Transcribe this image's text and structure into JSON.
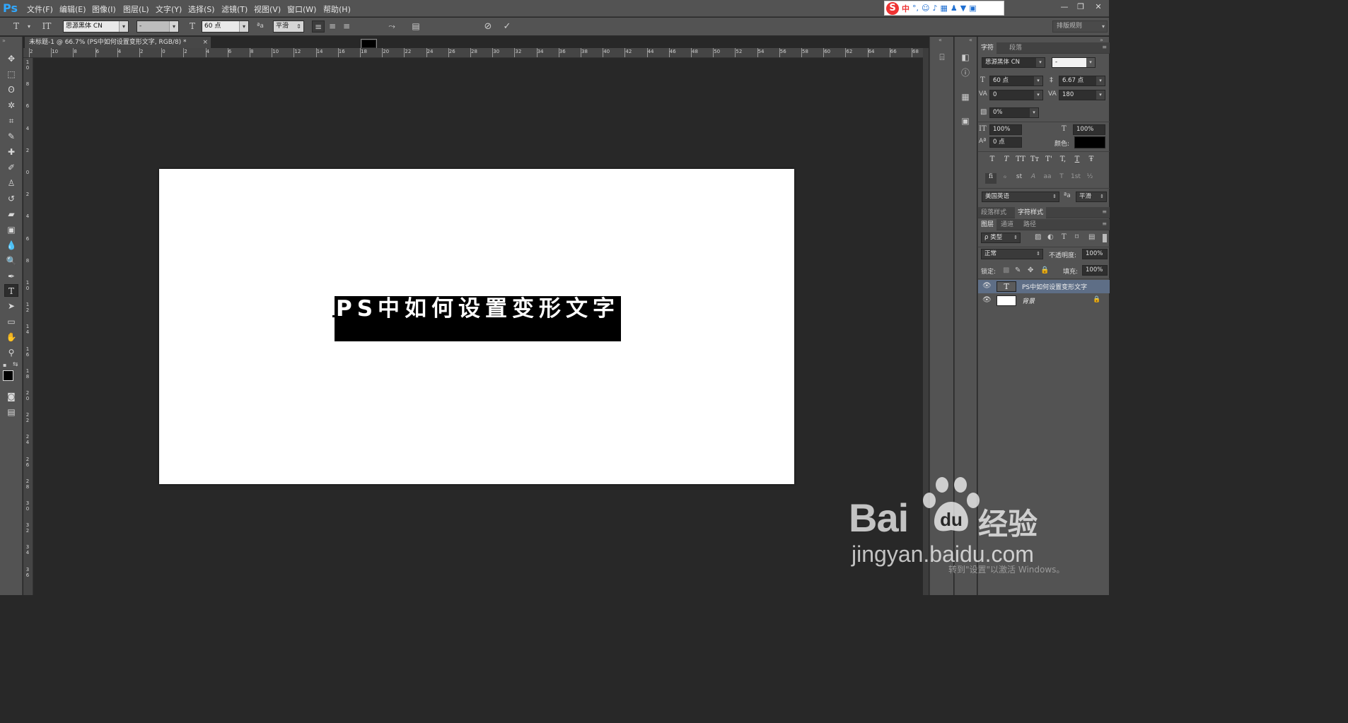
{
  "app": {
    "logo": "Ps"
  },
  "menu": [
    "文件(F)",
    "编辑(E)",
    "图像(I)",
    "图层(L)",
    "文字(Y)",
    "选择(S)",
    "滤镜(T)",
    "视图(V)",
    "窗口(W)",
    "帮助(H)"
  ],
  "ime": {
    "logo": "S",
    "mode": "中",
    "punct": "°,"
  },
  "window_controls": {
    "minimize": "—",
    "restore": "❐",
    "close": "✕"
  },
  "options": {
    "font_family": "思源黑体 CN",
    "font_style": "-",
    "font_size": "60 点",
    "antialias_icon_label": "ªa",
    "antialias": "平滑",
    "workspace": "排版规则"
  },
  "document": {
    "tab_title": "未标题-1 @ 66.7% (PS中如何设置变形文字, RGB/8) *",
    "text": "PS中如何设置变形文字",
    "text_color": "#000000"
  },
  "rulers": {
    "top": [
      "2",
      "10",
      "8",
      "6",
      "4",
      "2",
      "0",
      "2",
      "4",
      "6",
      "8",
      "10",
      "12",
      "14",
      "16",
      "18",
      "20",
      "22",
      "24",
      "26",
      "28",
      "30",
      "32",
      "34",
      "36",
      "38",
      "40",
      "42",
      "44",
      "46",
      "48",
      "50",
      "52",
      "54",
      "56",
      "58",
      "60",
      "62",
      "64",
      "66",
      "68"
    ],
    "left": [
      "1\n0",
      "8",
      "6",
      "4",
      "2",
      "0",
      "2",
      "4",
      "6",
      "8",
      "1\n0",
      "1\n2",
      "1\n4",
      "1\n6",
      "1\n8",
      "2\n0",
      "2\n2",
      "2\n4",
      "2\n6",
      "2\n8",
      "3\n0",
      "3\n2",
      "3\n4",
      "3\n6"
    ]
  },
  "character_panel": {
    "tabs": [
      "字符",
      "段落"
    ],
    "font_family": "思源黑体 CN",
    "font_style": "-",
    "font_size": "60 点",
    "leading": "6.67 点",
    "kerning": "0",
    "tracking": "180",
    "scale_pct": "0%",
    "vertical_scale": "100%",
    "horizontal_scale": "100%",
    "baseline_shift": "0 点",
    "color_label": "颜色:",
    "color": "#000000",
    "style_buttons": [
      "T",
      "T",
      "TT",
      "Tᴛ",
      "T'",
      "T,",
      "T",
      "Ŧ"
    ],
    "opentype_buttons": [
      "fi",
      "ℴ",
      "st",
      "A",
      "aa",
      "T",
      "1st",
      "½"
    ],
    "language": "美国英语",
    "aa_label": "ªa",
    "antialias": "平滑"
  },
  "style_tabs": [
    "段落样式",
    "字符样式"
  ],
  "layers_panel": {
    "tabs": [
      "图层",
      "通道",
      "路径"
    ],
    "filter": "ρ 类型",
    "blend_mode": "正常",
    "opacity_label": "不透明度:",
    "opacity": "100%",
    "lock_label": "锁定:",
    "fill_label": "填充:",
    "fill": "100%",
    "layers": [
      {
        "name": "PS中如何设置变形文字",
        "type": "text",
        "selected": true
      },
      {
        "name": "背景",
        "type": "background",
        "selected": false
      }
    ]
  },
  "watermark": {
    "brand": "Bai",
    "brand_tail": "du",
    "cn": "经验",
    "url": "jingyan.baidu.com"
  },
  "activation_notice": [
    "转到\"设置\"以激活 Windows。"
  ]
}
